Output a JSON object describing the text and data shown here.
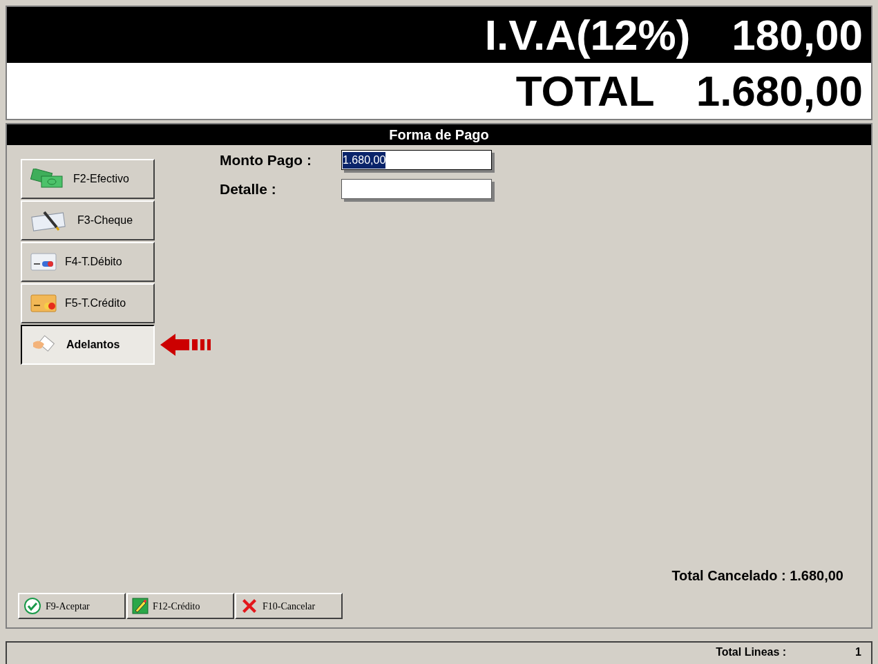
{
  "totals": [
    {
      "label": "I.V.A(12%)",
      "value": "180,00",
      "kind": "tax"
    },
    {
      "label": "TOTAL",
      "value": "1.680,00",
      "kind": "total"
    }
  ],
  "panel": {
    "title": "Forma de Pago",
    "payment_methods": [
      {
        "label": "F2-Efectivo",
        "kind": "cash",
        "selected": false
      },
      {
        "label": "F3-Cheque",
        "kind": "cheque",
        "selected": false
      },
      {
        "label": "F4-T.Débito",
        "kind": "debit",
        "selected": false
      },
      {
        "label": "F5-T.Crédito",
        "kind": "credit",
        "selected": false
      },
      {
        "label": "Adelantos",
        "kind": "advance",
        "selected": true
      }
    ],
    "fields": [
      {
        "label": "Monto Pago :",
        "value": "1.680,00",
        "selected": true
      },
      {
        "label": "Detalle :",
        "selected": false
      }
    ],
    "total_cancelado": "Total Cancelado : 1.680,00",
    "buttons": [
      {
        "label": "F9-Aceptar",
        "kind": "accept"
      },
      {
        "label": "F12-Crédito",
        "kind": "credit"
      },
      {
        "label": "F10-Cancelar",
        "kind": "cancel"
      }
    ]
  },
  "status_bar": {
    "label": "Total Lineas  :",
    "value": "1"
  }
}
